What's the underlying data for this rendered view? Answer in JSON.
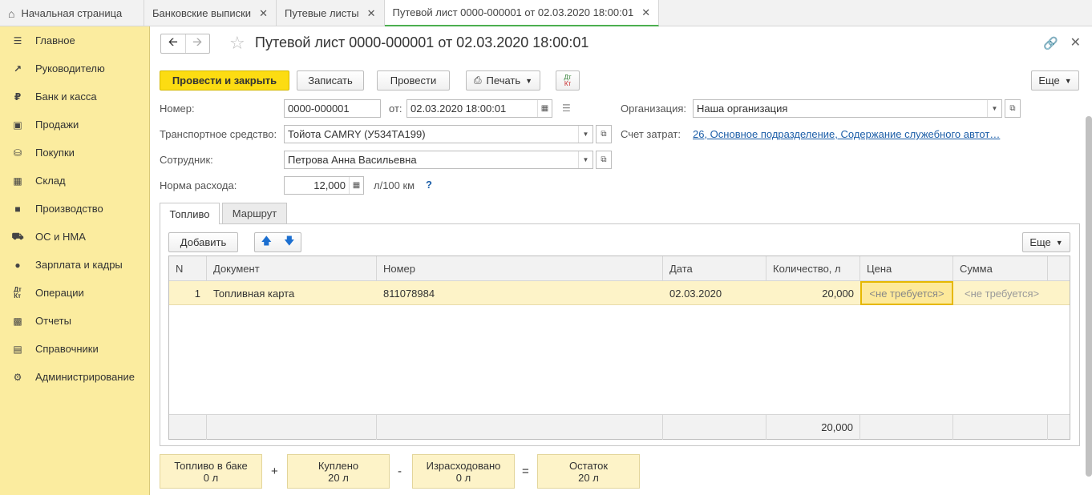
{
  "top_tabs": [
    {
      "label": "Начальная страница"
    },
    {
      "label": "Банковские выписки"
    },
    {
      "label": "Путевые листы"
    },
    {
      "label": "Путевой лист 0000-000001 от 02.03.2020 18:00:01"
    }
  ],
  "sidebar": {
    "items": [
      {
        "label": "Главное",
        "icon": "menu-icon"
      },
      {
        "label": "Руководителю",
        "icon": "trend-icon"
      },
      {
        "label": "Банк и касса",
        "icon": "ruble-icon"
      },
      {
        "label": "Продажи",
        "icon": "bag-icon"
      },
      {
        "label": "Покупки",
        "icon": "cart-icon"
      },
      {
        "label": "Склад",
        "icon": "grid-icon"
      },
      {
        "label": "Производство",
        "icon": "factory-icon"
      },
      {
        "label": "ОС и НМА",
        "icon": "truck-icon"
      },
      {
        "label": "Зарплата и кадры",
        "icon": "person-icon"
      },
      {
        "label": "Операции",
        "icon": "dt-kt-icon"
      },
      {
        "label": "Отчеты",
        "icon": "bar-chart-icon"
      },
      {
        "label": "Справочники",
        "icon": "book-icon"
      },
      {
        "label": "Администрирование",
        "icon": "gear-icon"
      }
    ]
  },
  "header": {
    "title": "Путевой лист 0000-000001 от 02.03.2020 18:00:01"
  },
  "toolbar": {
    "post_close": "Провести и закрыть",
    "save": "Записать",
    "post": "Провести",
    "print": "Печать",
    "dtkt_top": "Дт",
    "dtkt_bottom": "Кт",
    "more": "Еще"
  },
  "form": {
    "number_label": "Номер:",
    "number_value": "0000-000001",
    "date_label": "от:",
    "date_value": "02.03.2020 18:00:01",
    "org_label": "Организация:",
    "org_value": "Наша организация",
    "vehicle_label": "Транспортное средство:",
    "vehicle_value": "Тойота CAMRY (У534ТА199)",
    "account_label": "Счет затрат:",
    "account_value": "26, Основное подразделение, Содержание служебного автот…",
    "employee_label": "Сотрудник:",
    "employee_value": "Петрова Анна Васильевна",
    "norm_label": "Норма расхода:",
    "norm_value": "12,000",
    "norm_unit": "л/100 км",
    "help": "?"
  },
  "tabs": [
    {
      "label": "Топливо"
    },
    {
      "label": "Маршрут"
    }
  ],
  "table_toolbar": {
    "add": "Добавить",
    "more": "Еще"
  },
  "table": {
    "columns": [
      "N",
      "Документ",
      "Номер",
      "Дата",
      "Количество, л",
      "Цена",
      "Сумма"
    ],
    "rows": [
      {
        "n": "1",
        "doc": "Топливная карта",
        "number": "811078984",
        "date": "02.03.2020",
        "qty": "20,000",
        "price": "<не требуется>",
        "sum": "<не требуется>"
      }
    ],
    "footer_qty": "20,000"
  },
  "summary": {
    "in_tank_label": "Топливо в баке",
    "in_tank_value": "0 л",
    "plus": "+",
    "bought_label": "Куплено",
    "bought_value": "20 л",
    "minus": "-",
    "spent_label": "Израсходовано",
    "spent_value": "0 л",
    "equals": "=",
    "rest_label": "Остаток",
    "rest_value": "20 л"
  }
}
